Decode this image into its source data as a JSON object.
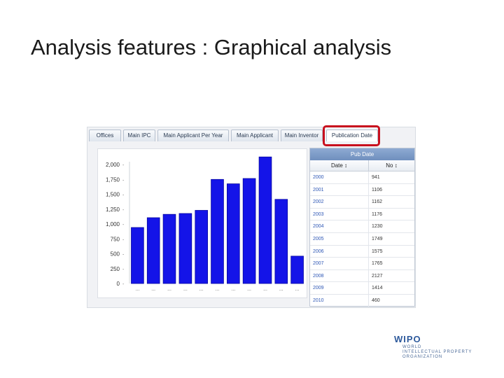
{
  "slide": {
    "title": "Analysis features : Graphical analysis"
  },
  "tabs": [
    {
      "label": "Offices"
    },
    {
      "label": "Main IPC"
    },
    {
      "label": "Main Applicant Per Year"
    },
    {
      "label": "Main Applicant"
    },
    {
      "label": "Main Inventor"
    },
    {
      "label": "Publication Date",
      "active": true
    }
  ],
  "colors": {
    "bar": "#1414e8",
    "highlight": "#c8101e",
    "table_header": "#7f9dcb",
    "link": "#2f58b6"
  },
  "chart_data": {
    "type": "bar",
    "categories": [
      "2000",
      "2001",
      "2002",
      "2003",
      "2004",
      "2005",
      "2006",
      "2007",
      "2008",
      "2009",
      "2010"
    ],
    "tick_labels_x": [
      "...",
      "...",
      "...",
      "...",
      "...",
      "...",
      "...",
      "...",
      "...",
      "...",
      "..."
    ],
    "values": [
      941,
      1106,
      1162,
      1176,
      1230,
      1749,
      1675,
      1765,
      2127,
      1414,
      460
    ],
    "yticks": [
      "0",
      "250",
      "500",
      "750",
      "1,000",
      "1,250",
      "1,500",
      "1,750",
      "2,000"
    ],
    "ylim": [
      0,
      2000
    ],
    "title": "",
    "xlabel": "",
    "ylabel": "",
    "grid": false,
    "bar_color": "#1414e8"
  },
  "table": {
    "title": "Pub Date",
    "columns": [
      "Date ↕",
      "No ↕"
    ],
    "rows": [
      {
        "date": "2000",
        "no": "941"
      },
      {
        "date": "2001",
        "no": "1106"
      },
      {
        "date": "2002",
        "no": "1162"
      },
      {
        "date": "2003",
        "no": "1176"
      },
      {
        "date": "2004",
        "no": "1230"
      },
      {
        "date": "2005",
        "no": "1749"
      },
      {
        "date": "2006",
        "no": "1575"
      },
      {
        "date": "2007",
        "no": "1765"
      },
      {
        "date": "2008",
        "no": "2127"
      },
      {
        "date": "2009",
        "no": "1414"
      },
      {
        "date": "2010",
        "no": "460"
      }
    ]
  },
  "logo": {
    "mark": "WIPO",
    "line1": "WORLD",
    "line2": "INTELLECTUAL PROPERTY",
    "line3": "ORGANIZATION"
  }
}
